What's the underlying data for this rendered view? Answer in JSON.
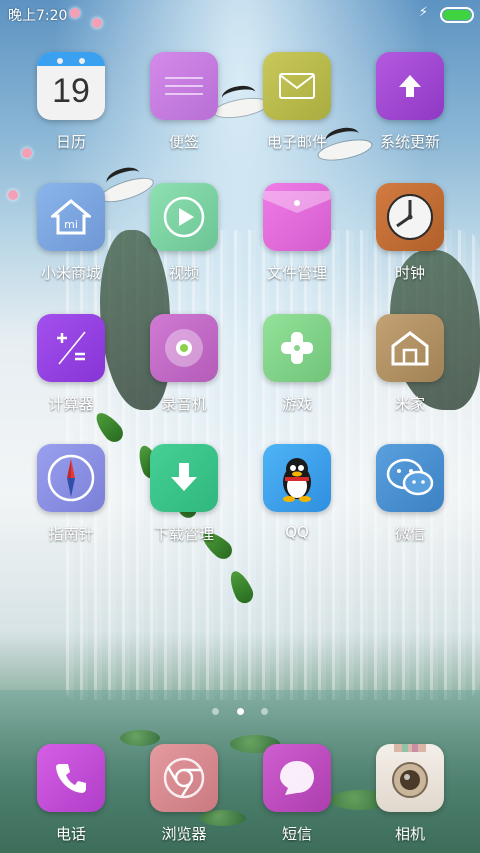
{
  "status_bar": {
    "time": "晚上7:20",
    "battery_level": 1.0,
    "charging_icon": "lightning-icon",
    "battery_color": "#3fd43f"
  },
  "grid": [
    {
      "label": "日历",
      "icon": "calendar-icon",
      "day": "19",
      "color": "#f2f2f2"
    },
    {
      "label": "便签",
      "icon": "notes-icon",
      "color": "#c47fe0"
    },
    {
      "label": "电子邮件",
      "icon": "envelope-icon",
      "color": "#b6b94a"
    },
    {
      "label": "系统更新",
      "icon": "upload-arrow-icon",
      "color": "#a44ad0"
    },
    {
      "label": "小米商城",
      "icon": "mi-house-icon",
      "color": "#7ca9e2"
    },
    {
      "label": "视频",
      "icon": "play-icon",
      "color": "#7fd1a4"
    },
    {
      "label": "文件管理",
      "icon": "folder-icon",
      "color": "#e36ad8"
    },
    {
      "label": "时钟",
      "icon": "clock-icon",
      "color": "#c36d35"
    },
    {
      "label": "计算器",
      "icon": "calculator-icon",
      "color": "#9a44e6"
    },
    {
      "label": "录音机",
      "icon": "record-icon",
      "color": "#c56fca"
    },
    {
      "label": "游戏",
      "icon": "gamepad-icon",
      "color": "#86d58d"
    },
    {
      "label": "米家",
      "icon": "home-icon",
      "color": "#b49565"
    },
    {
      "label": "指南针",
      "icon": "compass-icon",
      "color": "#8a8fe6"
    },
    {
      "label": "下载管理",
      "icon": "download-icon",
      "color": "#38c58a"
    },
    {
      "label": "QQ",
      "icon": "penguin-icon",
      "color": "#3aa0f0"
    },
    {
      "label": "微信",
      "icon": "chat-bubbles-icon",
      "color": "#4a8fd0"
    }
  ],
  "page_indicator": {
    "count": 3,
    "active_index": 1
  },
  "dock": [
    {
      "label": "电话",
      "icon": "phone-icon",
      "color": "#c34ad6"
    },
    {
      "label": "浏览器",
      "icon": "chrome-icon",
      "color": "#d48a8f"
    },
    {
      "label": "短信",
      "icon": "message-icon",
      "color": "#c14fc0"
    },
    {
      "label": "相机",
      "icon": "camera-icon",
      "color": "#eee7df"
    }
  ]
}
